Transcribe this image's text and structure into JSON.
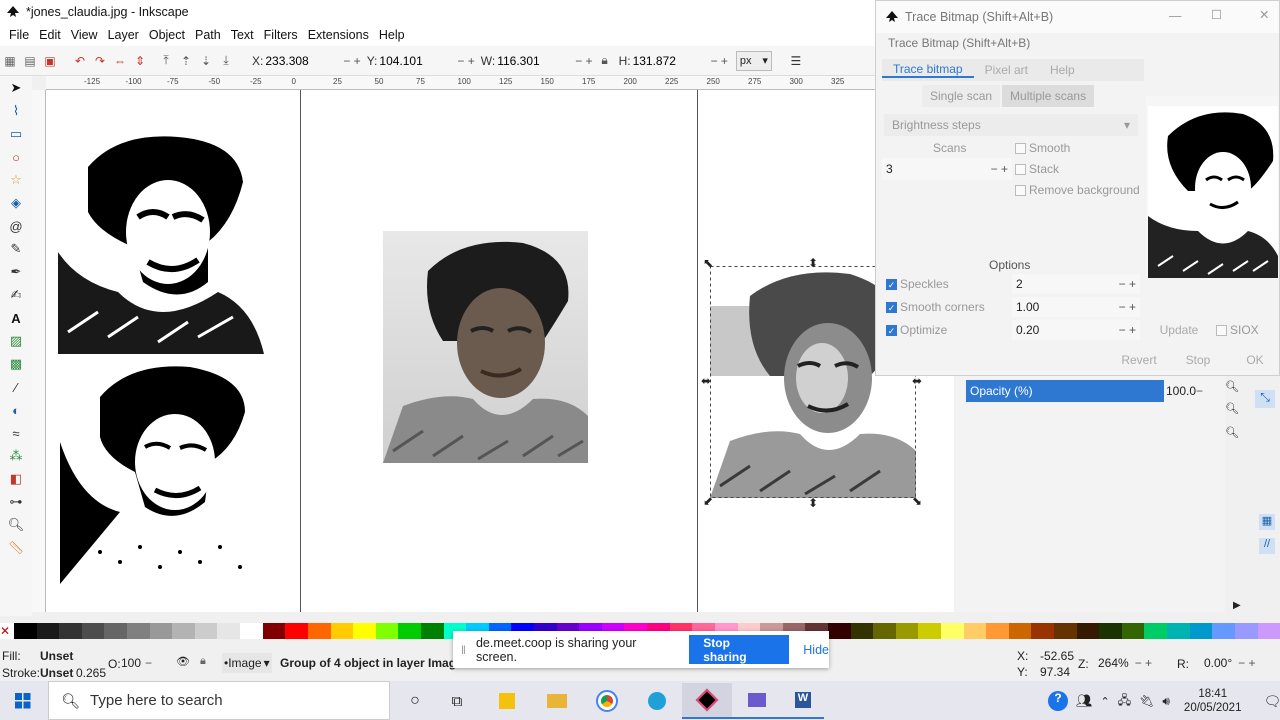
{
  "window": {
    "title": "*jones_claudia.jpg - Inkscape"
  },
  "menu": [
    "File",
    "Edit",
    "View",
    "Layer",
    "Object",
    "Path",
    "Text",
    "Filters",
    "Extensions",
    "Help"
  ],
  "toolbar": {
    "x_label": "X:",
    "x_value": "233.308",
    "y_label": "Y:",
    "y_value": "104.101",
    "w_label": "W:",
    "w_value": "116.301",
    "h_label": "H:",
    "h_value": "131.872",
    "unit": "px"
  },
  "ruler_ticks": [
    "-125",
    "-100",
    "-75",
    "-50",
    "-25",
    "0",
    "25",
    "50",
    "75",
    "100",
    "125",
    "150",
    "175",
    "200",
    "225",
    "250",
    "275",
    "300",
    "325"
  ],
  "dialog": {
    "title": "Trace Bitmap (Shift+Alt+B)",
    "subtitle": "Trace Bitmap (Shift+Alt+B)",
    "tabs": [
      "Trace bitmap",
      "Pixel art",
      "Help"
    ],
    "scan_modes": [
      "Single scan",
      "Multiple scans"
    ],
    "mode": "Brightness steps",
    "scans_label": "Scans",
    "scans_value": "3",
    "chk_smooth": "Smooth",
    "chk_stack": "Stack",
    "chk_remove_bg": "Remove background",
    "options_label": "Options",
    "speckles_label": "Speckles",
    "speckles_value": "2",
    "smooth_corners_label": "Smooth corners",
    "smooth_corners_value": "1.00",
    "optimize_label": "Optimize",
    "optimize_value": "0.20",
    "update": "Update",
    "siox": "SIOX",
    "revert": "Revert",
    "stop": "Stop",
    "ok": "OK"
  },
  "opacity": {
    "label": "Opacity (%)",
    "value": "100.0"
  },
  "status": {
    "fill_label": "Fill:",
    "fill_value": "Unset",
    "stroke_label": "Stroke:",
    "stroke_value": "Unset",
    "stroke_width": "0.265",
    "opacity_label": "O:",
    "opacity_value": "100",
    "layer": "•Image",
    "message": "Group of 4 object in layer Imag",
    "x_label": "X:",
    "x_value": "-52.65",
    "y_label": "Y:",
    "y_value": "97.34",
    "zoom_label": "Z:",
    "zoom_value": "264%",
    "rotate_label": "R:",
    "rotate_value": "0.00°"
  },
  "share": {
    "message": "de.meet.coop is sharing your screen.",
    "stop": "Stop sharing",
    "hide": "Hide"
  },
  "taskbar": {
    "search_placeholder": "Type here to search",
    "time": "18:41",
    "date": "20/05/2021"
  },
  "colors": {
    "accent": "#2e78d1",
    "share_blue": "#1a73e8",
    "opacity_bar": "#2e78d1"
  },
  "palette": [
    "#000000",
    "#1a1a1a",
    "#333333",
    "#4d4d4d",
    "#666666",
    "#808080",
    "#999999",
    "#b3b3b3",
    "#cccccc",
    "#e6e6e6",
    "#ffffff",
    "#800000",
    "#ff0000",
    "#ff6600",
    "#ffcc00",
    "#ffff00",
    "#80ff00",
    "#00cc00",
    "#008000",
    "#00ffcc",
    "#00ccff",
    "#0066ff",
    "#0000ff",
    "#3300cc",
    "#6600cc",
    "#9900ff",
    "#cc00ff",
    "#ff00cc",
    "#ff0080",
    "#ff3366",
    "#ff6699",
    "#ff99cc",
    "#ffcccc",
    "#cc9999",
    "#996666",
    "#663333",
    "#330000",
    "#333300",
    "#666600",
    "#999900",
    "#cccc00",
    "#ffff66",
    "#ffcc66",
    "#ff9933",
    "#cc6600",
    "#993300",
    "#663300",
    "#331a00",
    "#1a3300",
    "#336600",
    "#00cc66",
    "#00b3b3",
    "#0099cc",
    "#6699ff",
    "#9999ff",
    "#cc99ff"
  ]
}
